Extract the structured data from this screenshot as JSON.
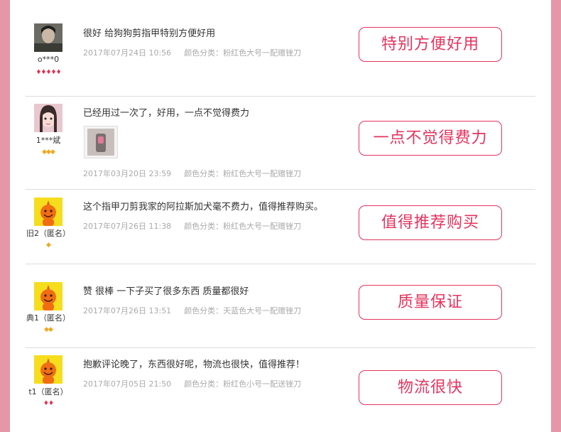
{
  "reviews": [
    {
      "user": "o***0",
      "avatar_icon": "user-photo-dark",
      "level_icon": "red-gem-icon",
      "level_count": 5,
      "comment": "很好 给狗狗剪指甲特别方便好用",
      "date": "2017年07月24日 10:56",
      "variant": "颜色分类：粉红色大号一配赠锉刀",
      "tag": "特别方便好用"
    },
    {
      "user": "1***斌",
      "avatar_icon": "user-photo-girl",
      "level_icon": "gold-diamond-icon",
      "level_count": 3,
      "comment": "已经用过一次了，好用，一点不觉得费力",
      "has_photo": true,
      "date": "2017年03月20日 23:59",
      "variant": "颜色分类：粉红色大号一配赠锉刀",
      "tag": "一点不觉得费力"
    },
    {
      "user": "旧2（匿名）",
      "avatar_icon": "taobao-anonymous-avatar",
      "level_icon": "gold-diamond-icon",
      "level_count": 1,
      "comment": "这个指甲刀剪我家的阿拉斯加犬毫不费力，值得推荐购买。",
      "date": "2017年07月26日 11:38",
      "variant": "颜色分类：粉红色大号一配赠锉刀",
      "tag": "值得推荐购买"
    },
    {
      "user": "典1（匿名）",
      "avatar_icon": "taobao-anonymous-avatar",
      "level_icon": "gold-diamond-icon",
      "level_count": 2,
      "comment": "赞 很棒 一下子买了很多东西 质量都很好",
      "date": "2017年07月26日 13:51",
      "variant": "颜色分类：天蓝色大号一配赠锉刀",
      "tag": "质量保证"
    },
    {
      "user": "t1（匿名）",
      "avatar_icon": "taobao-anonymous-avatar",
      "level_icon": "red-gem-icon",
      "level_count": 2,
      "comment": "抱歉评论晚了，东西很好呢，物流也很快，值得推荐！",
      "date": "2017年07月05日 21:50",
      "variant": "颜色分类：粉红色小号一配送锉刀",
      "tag": "物流很快"
    }
  ],
  "colors": {
    "accent": "#e5345f",
    "page_border": "#e597a7",
    "gem_red": "#e8314f",
    "gem_gold": "#f2a71c"
  }
}
